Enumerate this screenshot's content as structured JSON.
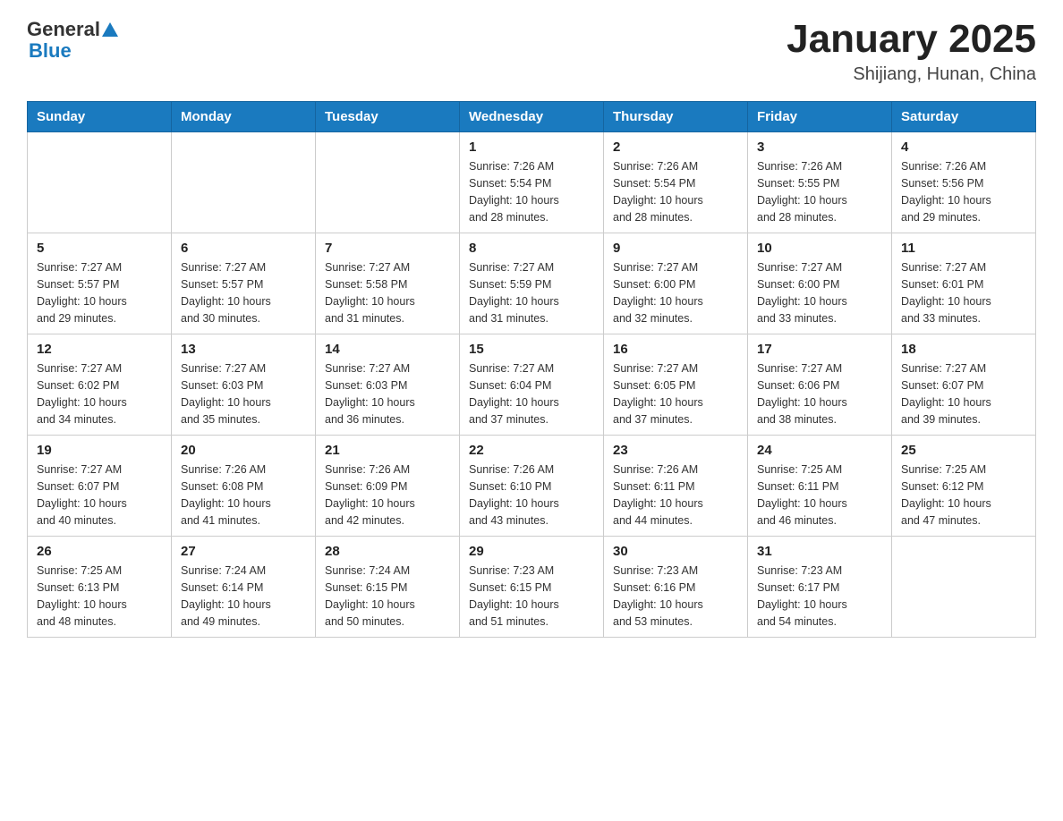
{
  "header": {
    "logo": {
      "general": "General",
      "blue": "Blue",
      "aria": "GeneralBlue logo"
    },
    "title": "January 2025",
    "subtitle": "Shijiang, Hunan, China"
  },
  "days_of_week": [
    "Sunday",
    "Monday",
    "Tuesday",
    "Wednesday",
    "Thursday",
    "Friday",
    "Saturday"
  ],
  "weeks": [
    [
      {
        "day": "",
        "info": ""
      },
      {
        "day": "",
        "info": ""
      },
      {
        "day": "",
        "info": ""
      },
      {
        "day": "1",
        "info": "Sunrise: 7:26 AM\nSunset: 5:54 PM\nDaylight: 10 hours\nand 28 minutes."
      },
      {
        "day": "2",
        "info": "Sunrise: 7:26 AM\nSunset: 5:54 PM\nDaylight: 10 hours\nand 28 minutes."
      },
      {
        "day": "3",
        "info": "Sunrise: 7:26 AM\nSunset: 5:55 PM\nDaylight: 10 hours\nand 28 minutes."
      },
      {
        "day": "4",
        "info": "Sunrise: 7:26 AM\nSunset: 5:56 PM\nDaylight: 10 hours\nand 29 minutes."
      }
    ],
    [
      {
        "day": "5",
        "info": "Sunrise: 7:27 AM\nSunset: 5:57 PM\nDaylight: 10 hours\nand 29 minutes."
      },
      {
        "day": "6",
        "info": "Sunrise: 7:27 AM\nSunset: 5:57 PM\nDaylight: 10 hours\nand 30 minutes."
      },
      {
        "day": "7",
        "info": "Sunrise: 7:27 AM\nSunset: 5:58 PM\nDaylight: 10 hours\nand 31 minutes."
      },
      {
        "day": "8",
        "info": "Sunrise: 7:27 AM\nSunset: 5:59 PM\nDaylight: 10 hours\nand 31 minutes."
      },
      {
        "day": "9",
        "info": "Sunrise: 7:27 AM\nSunset: 6:00 PM\nDaylight: 10 hours\nand 32 minutes."
      },
      {
        "day": "10",
        "info": "Sunrise: 7:27 AM\nSunset: 6:00 PM\nDaylight: 10 hours\nand 33 minutes."
      },
      {
        "day": "11",
        "info": "Sunrise: 7:27 AM\nSunset: 6:01 PM\nDaylight: 10 hours\nand 33 minutes."
      }
    ],
    [
      {
        "day": "12",
        "info": "Sunrise: 7:27 AM\nSunset: 6:02 PM\nDaylight: 10 hours\nand 34 minutes."
      },
      {
        "day": "13",
        "info": "Sunrise: 7:27 AM\nSunset: 6:03 PM\nDaylight: 10 hours\nand 35 minutes."
      },
      {
        "day": "14",
        "info": "Sunrise: 7:27 AM\nSunset: 6:03 PM\nDaylight: 10 hours\nand 36 minutes."
      },
      {
        "day": "15",
        "info": "Sunrise: 7:27 AM\nSunset: 6:04 PM\nDaylight: 10 hours\nand 37 minutes."
      },
      {
        "day": "16",
        "info": "Sunrise: 7:27 AM\nSunset: 6:05 PM\nDaylight: 10 hours\nand 37 minutes."
      },
      {
        "day": "17",
        "info": "Sunrise: 7:27 AM\nSunset: 6:06 PM\nDaylight: 10 hours\nand 38 minutes."
      },
      {
        "day": "18",
        "info": "Sunrise: 7:27 AM\nSunset: 6:07 PM\nDaylight: 10 hours\nand 39 minutes."
      }
    ],
    [
      {
        "day": "19",
        "info": "Sunrise: 7:27 AM\nSunset: 6:07 PM\nDaylight: 10 hours\nand 40 minutes."
      },
      {
        "day": "20",
        "info": "Sunrise: 7:26 AM\nSunset: 6:08 PM\nDaylight: 10 hours\nand 41 minutes."
      },
      {
        "day": "21",
        "info": "Sunrise: 7:26 AM\nSunset: 6:09 PM\nDaylight: 10 hours\nand 42 minutes."
      },
      {
        "day": "22",
        "info": "Sunrise: 7:26 AM\nSunset: 6:10 PM\nDaylight: 10 hours\nand 43 minutes."
      },
      {
        "day": "23",
        "info": "Sunrise: 7:26 AM\nSunset: 6:11 PM\nDaylight: 10 hours\nand 44 minutes."
      },
      {
        "day": "24",
        "info": "Sunrise: 7:25 AM\nSunset: 6:11 PM\nDaylight: 10 hours\nand 46 minutes."
      },
      {
        "day": "25",
        "info": "Sunrise: 7:25 AM\nSunset: 6:12 PM\nDaylight: 10 hours\nand 47 minutes."
      }
    ],
    [
      {
        "day": "26",
        "info": "Sunrise: 7:25 AM\nSunset: 6:13 PM\nDaylight: 10 hours\nand 48 minutes."
      },
      {
        "day": "27",
        "info": "Sunrise: 7:24 AM\nSunset: 6:14 PM\nDaylight: 10 hours\nand 49 minutes."
      },
      {
        "day": "28",
        "info": "Sunrise: 7:24 AM\nSunset: 6:15 PM\nDaylight: 10 hours\nand 50 minutes."
      },
      {
        "day": "29",
        "info": "Sunrise: 7:23 AM\nSunset: 6:15 PM\nDaylight: 10 hours\nand 51 minutes."
      },
      {
        "day": "30",
        "info": "Sunrise: 7:23 AM\nSunset: 6:16 PM\nDaylight: 10 hours\nand 53 minutes."
      },
      {
        "day": "31",
        "info": "Sunrise: 7:23 AM\nSunset: 6:17 PM\nDaylight: 10 hours\nand 54 minutes."
      },
      {
        "day": "",
        "info": ""
      }
    ]
  ]
}
